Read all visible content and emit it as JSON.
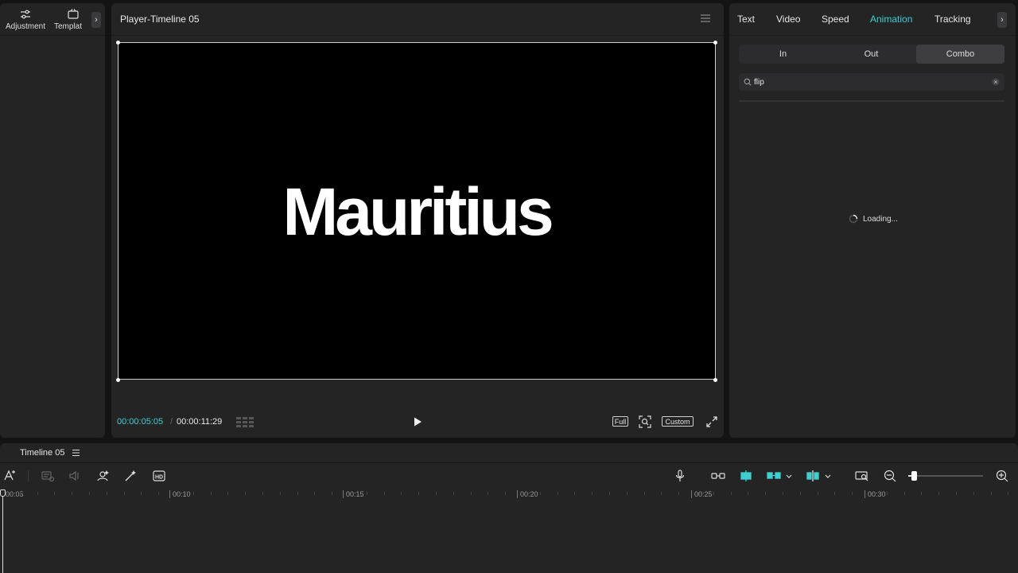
{
  "left_panel": {
    "tabs": [
      {
        "label": "Adjustment",
        "icon": "sliders-icon"
      },
      {
        "label": "Templat",
        "icon": "template-icon"
      }
    ],
    "more": "›"
  },
  "player": {
    "title": "Player-Timeline 05",
    "canvas_text": "Mauritius",
    "time_current": "00:00:05:05",
    "time_separator": "/",
    "time_total": "00:00:11:29",
    "full_label": "Full",
    "custom_label": "Custom"
  },
  "right_panel": {
    "tabs": [
      "Text",
      "Video",
      "Speed",
      "Animation",
      "Tracking"
    ],
    "active_tab": "Animation",
    "more": "›",
    "subtabs": [
      "In",
      "Out",
      "Combo"
    ],
    "active_subtab": "Combo",
    "search": {
      "value": "flip"
    },
    "loading_text": "Loading..."
  },
  "timeline": {
    "title": "Timeline 05",
    "ruler_labels": [
      "00:05",
      "00:10",
      "00:15",
      "00:20",
      "00:25",
      "00:30"
    ],
    "zoom_level": 0.05
  },
  "colors": {
    "accent": "#3ecfd0",
    "panel_bg": "#242425",
    "app_bg": "#141414"
  }
}
